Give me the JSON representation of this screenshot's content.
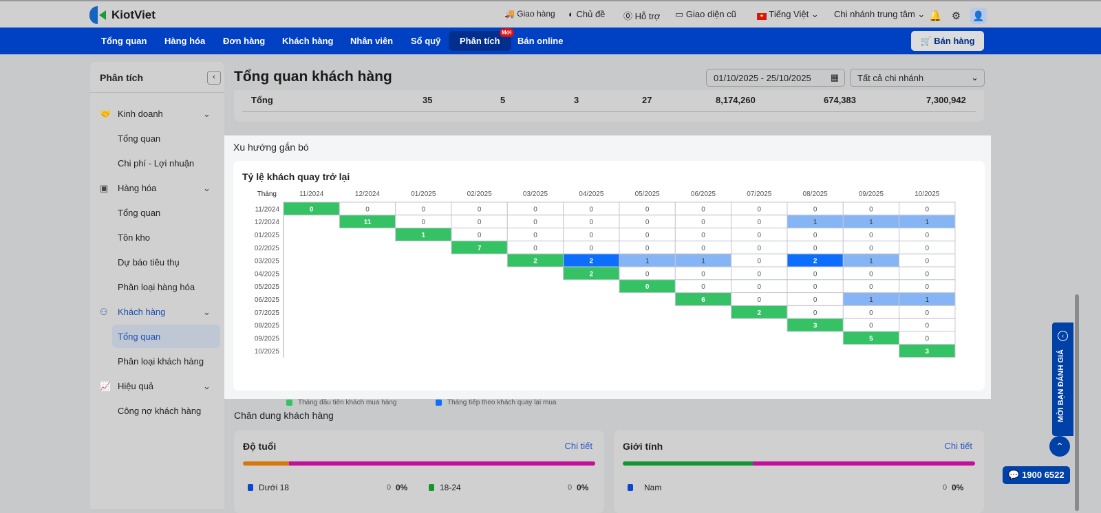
{
  "topbar": {
    "brand": "KiotViet",
    "links": [
      "Giao hàng",
      "Chủ đề",
      "Hỗ trợ",
      "Giao diện cũ",
      "Tiếng Việt",
      "Chi nhánh trung tâm"
    ]
  },
  "nav": {
    "items": [
      "Tổng quan",
      "Hàng hóa",
      "Đơn hàng",
      "Khách hàng",
      "Nhân viên",
      "Sổ quỹ",
      "Phân tích",
      "Bán online"
    ],
    "badge": "Mới",
    "sell": "Bán hàng"
  },
  "sidebar": {
    "title": "Phân tích",
    "groups": [
      {
        "label": "Kinh doanh",
        "subs": [
          "Tổng quan",
          "Chi phí - Lợi nhuận"
        ]
      },
      {
        "label": "Hàng hóa",
        "subs": [
          "Tổng quan",
          "Tồn kho",
          "Dự báo tiêu thụ",
          "Phân loại hàng hóa"
        ]
      },
      {
        "label": "Khách hàng",
        "subs": [
          "Tổng quan",
          "Phân loại khách hàng"
        ]
      },
      {
        "label": "Hiệu quả",
        "subs": [
          "Công nợ khách hàng"
        ]
      }
    ]
  },
  "page": {
    "title": "Tổng quan khách hàng",
    "date_range": "01/10/2025 - 25/10/2025",
    "branch": "Tất cả chi nhánh"
  },
  "totals": {
    "label": "Tổng",
    "values": [
      "35",
      "5",
      "3",
      "27",
      "8,174,260",
      "674,383",
      "7,300,942"
    ]
  },
  "retention": {
    "section": "Xu hướng gắn bó",
    "title": "Tỷ lệ khách quay trở lại",
    "corner": "Tháng",
    "legend": [
      "Tháng đầu tiên khách mua hàng",
      "Tháng tiếp theo khách quay lại mua"
    ],
    "colors": {
      "first": "#34c265",
      "strong": "#0d6efd",
      "light": "#86b5f5"
    }
  },
  "chart_data": {
    "type": "heatmap",
    "title": "Tỷ lệ khách quay trở lại",
    "months": [
      "11/2024",
      "12/2024",
      "01/2025",
      "02/2025",
      "03/2025",
      "04/2025",
      "05/2025",
      "06/2025",
      "07/2025",
      "08/2025",
      "09/2025",
      "10/2025"
    ],
    "rows": [
      [
        0,
        0,
        0,
        0,
        0,
        0,
        0,
        0,
        0,
        0,
        0,
        0
      ],
      [
        11,
        0,
        0,
        0,
        0,
        0,
        0,
        0,
        1,
        1,
        1
      ],
      [
        1,
        0,
        0,
        0,
        0,
        0,
        0,
        0,
        0,
        0
      ],
      [
        7,
        0,
        0,
        0,
        0,
        0,
        0,
        0,
        0
      ],
      [
        2,
        2,
        1,
        1,
        0,
        2,
        1,
        0
      ],
      [
        2,
        0,
        0,
        0,
        0,
        0,
        0
      ],
      [
        0,
        0,
        0,
        0,
        0,
        0
      ],
      [
        6,
        0,
        0,
        1,
        1
      ],
      [
        2,
        0,
        0,
        0
      ],
      [
        3,
        0,
        0
      ],
      [
        5,
        0
      ],
      [
        3
      ]
    ]
  },
  "portrait": {
    "title": "Chân dung khách hàng",
    "age": {
      "title": "Độ tuổi",
      "detail": "Chi tiết",
      "bar": [
        {
          "color": "#d4780a",
          "pct": 13
        },
        {
          "color": "#c30f99",
          "pct": 87
        }
      ],
      "items": [
        {
          "label": "Dưới 18",
          "count": "0",
          "pct": "0%",
          "color": "#0b45d1"
        },
        {
          "label": "18-24",
          "count": "0",
          "pct": "0%",
          "color": "#12962f"
        }
      ]
    },
    "gender": {
      "title": "Giới tính",
      "detail": "Chi tiết",
      "bar": [
        {
          "color": "#14962f",
          "pct": 37
        },
        {
          "color": "#c30f99",
          "pct": 63
        }
      ],
      "items": [
        {
          "label": "Nam",
          "count": "0",
          "pct": "0%",
          "color": "#0b45d1"
        }
      ]
    }
  },
  "feedback": "MỜI BẠN ĐÁNH GIÁ",
  "hotline": "1900 6522"
}
